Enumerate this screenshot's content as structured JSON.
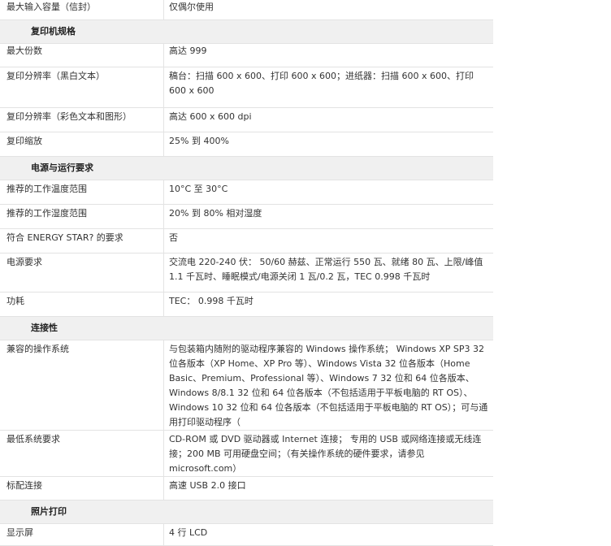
{
  "rows": [
    {
      "type": "row",
      "label": "最大输入容量（信封）",
      "value": "仅偶尔使用"
    },
    {
      "type": "section",
      "label": "复印机规格"
    },
    {
      "type": "row",
      "label": "最大份数",
      "value": "高达 999"
    },
    {
      "type": "row",
      "label": "复印分辨率（黑白文本）",
      "value": "稿台：扫描 600 x 600、打印 600 x 600；进纸器：扫描 600 x 600、打印 600 x 600"
    },
    {
      "type": "row",
      "label": "复印分辨率（彩色文本和图形）",
      "value": "高达 600 x 600 dpi"
    },
    {
      "type": "row",
      "label": "复印缩放",
      "value": "25% 到 400%"
    },
    {
      "type": "section",
      "label": "电源与运行要求"
    },
    {
      "type": "row",
      "label": "推荐的工作温度范围",
      "value": "10°C 至 30°C"
    },
    {
      "type": "row",
      "label": "推荐的工作湿度范围",
      "value": "20% 到 80% 相对湿度"
    },
    {
      "type": "row",
      "label": "符合 ENERGY STAR? 的要求",
      "value": "否"
    },
    {
      "type": "row",
      "label": "电源要求",
      "value": "交流电 220-240 伏： 50/60 赫兹、正常运行 550 瓦、就绪 80 瓦、上限/峰值 1.1 千瓦时、睡眠模式/电源关闭 1 瓦/0.2 瓦，TEC 0.998 千瓦时"
    },
    {
      "type": "row",
      "label": "功耗",
      "value": "TEC： 0.998 千瓦时"
    },
    {
      "type": "section",
      "label": "连接性"
    },
    {
      "type": "row",
      "label": "兼容的操作系统",
      "value": "与包装箱内随附的驱动程序兼容的 Windows 操作系统； Windows XP SP3 32 位各版本（XP Home、XP Pro 等）、Windows Vista 32 位各版本（Home Basic、Premium、Professional 等）、Windows 7 32 位和 64 位各版本、Windows 8/8.1 32 位和 64 位各版本（不包括适用于平板电脑的 RT OS）、Windows 10 32 位和 64 位各版本（不包括适用于平板电脑的 RT OS）；可与通用打印驱动程序（"
    },
    {
      "type": "row",
      "label": "最低系统要求",
      "value": "CD-ROM 或 DVD 驱动器或 Internet 连接； 专用的 USB 或网络连接或无线连接；200 MB 可用硬盘空间；（有关操作系统的硬件要求，请参见 microsoft.com）"
    },
    {
      "type": "row",
      "label": "标配连接",
      "value": "高速 USB 2.0 接口"
    },
    {
      "type": "section",
      "label": "照片打印"
    },
    {
      "type": "row",
      "label": "显示屏",
      "value": "4 行 LCD"
    }
  ]
}
